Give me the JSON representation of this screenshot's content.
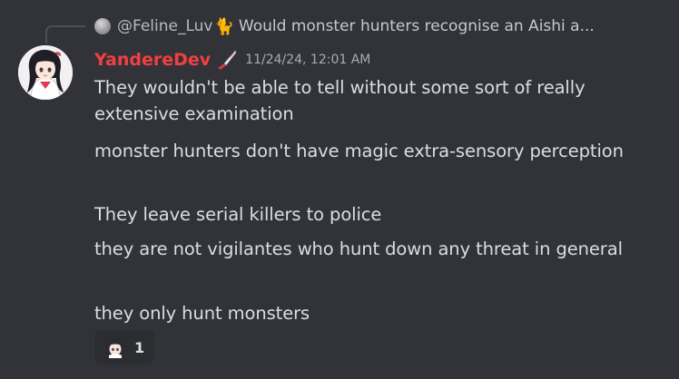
{
  "reply": {
    "author": "@Feline_Luv",
    "author_icon": "cat-icon",
    "preview": "Would monster hunters recognise an Aishi a..."
  },
  "message": {
    "author": "YandereDev",
    "author_color": "#f23f42",
    "author_icon": "knife-icon",
    "timestamp": "11/24/24, 12:01 AM",
    "lines": [
      "They wouldn't be able to tell without some sort of really extensive examination",
      "monster hunters don't have magic extra-sensory perception",
      "They leave serial killers to police",
      "they are not vigilantes who hunt down any threat in general",
      "they only hunt monsters"
    ]
  },
  "reaction": {
    "emoji": "anime-girl-emoji",
    "count": "1"
  }
}
